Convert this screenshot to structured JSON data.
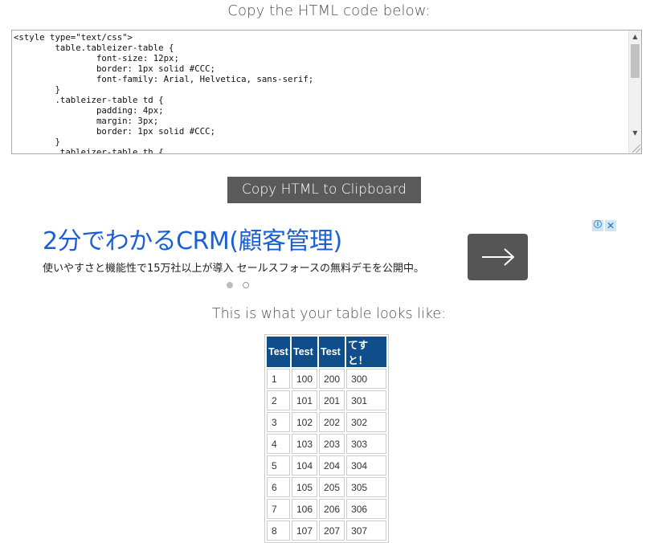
{
  "page": {
    "copy_heading": "Copy the HTML code below:",
    "preview_heading": "This is what your table looks like:"
  },
  "code_box": {
    "lines": [
      "<style type=\"text/css\">",
      "        table.tableizer-table {",
      "                font-size: 12px;",
      "                border: 1px solid #CCC;",
      "                font-family: Arial, Helvetica, sans-serif;",
      "        }",
      "        .tableizer-table td {",
      "                padding: 4px;",
      "                margin: 3px;",
      "                border: 1px solid #CCC;",
      "        }",
      "        .tableizer-table th {"
    ]
  },
  "copy_button": {
    "label": "Copy HTML to Clipboard"
  },
  "ad": {
    "title": "2分でわかるCRM(顧客管理)",
    "description": "使いやすさと機能性で15万社以上が導入 セールスフォースの無料デモを公開中。",
    "info_icon": "ⓘ",
    "close_icon": "✕",
    "carousel": {
      "active_index": 0,
      "count": 2
    },
    "colors": {
      "title": "#1a5fd6",
      "button": "#555555"
    }
  },
  "table": {
    "headers": [
      "Test",
      "Test",
      "Test",
      "てすと！"
    ],
    "rows": [
      [
        "1",
        "100",
        "200",
        "300"
      ],
      [
        "2",
        "101",
        "201",
        "301"
      ],
      [
        "3",
        "102",
        "202",
        "302"
      ],
      [
        "4",
        "103",
        "203",
        "303"
      ],
      [
        "5",
        "104",
        "204",
        "304"
      ],
      [
        "6",
        "105",
        "205",
        "305"
      ],
      [
        "7",
        "106",
        "206",
        "306"
      ],
      [
        "8",
        "107",
        "207",
        "307"
      ]
    ],
    "colors": {
      "header_bg": "#104e8b",
      "header_text": "#ffffff",
      "border": "#cccccc"
    }
  }
}
